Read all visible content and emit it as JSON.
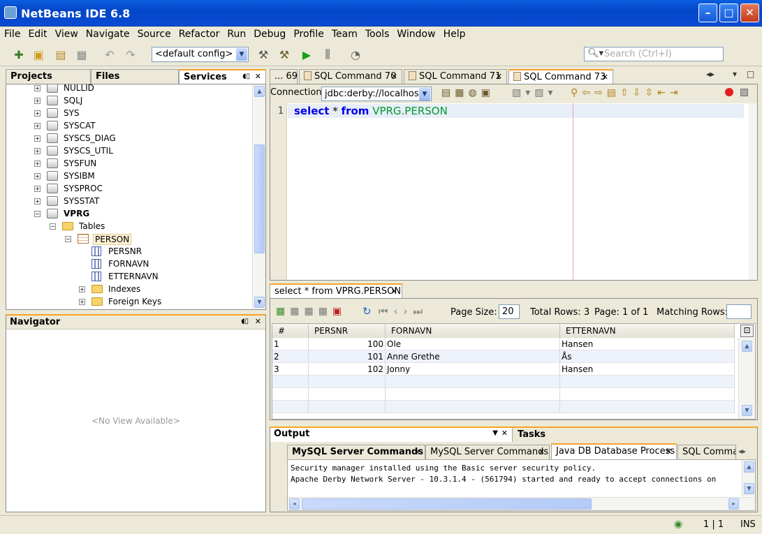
{
  "window": {
    "title": "NetBeans IDE 6.8"
  },
  "menu": [
    "File",
    "Edit",
    "View",
    "Navigate",
    "Source",
    "Refactor",
    "Run",
    "Debug",
    "Profile",
    "Team",
    "Tools",
    "Window",
    "Help"
  ],
  "toolbar": {
    "config_value": "<default config>",
    "search_placeholder": "Search (Ctrl+I)"
  },
  "left_tabs": {
    "projects": "Projects",
    "files": "Files",
    "services": "Services"
  },
  "tree": {
    "schemas": [
      "NULLID",
      "SQLJ",
      "SYS",
      "SYSCAT",
      "SYSCS_DIAG",
      "SYSCS_UTIL",
      "SYSFUN",
      "SYSIBM",
      "SYSPROC",
      "SYSSTAT",
      "VPRG"
    ],
    "tables_label": "Tables",
    "table_name": "PERSON",
    "columns": [
      "PERSNR",
      "FORNAVN",
      "ETTERNAVN"
    ],
    "indexes_label": "Indexes",
    "foreign_keys_label": "Foreign Keys"
  },
  "navigator": {
    "title": "Navigator",
    "empty_text": "<No View Available>"
  },
  "editor_tabs": [
    "... 69",
    "SQL Command 70",
    "SQL Command 71",
    "SQL Command 73"
  ],
  "connection": {
    "label": "Connection:",
    "value": "jdbc:derby://localhos..."
  },
  "editor": {
    "line_number": "1",
    "kw_select": "select",
    "star": "*",
    "kw_from": "from",
    "table_ref": "VPRG.PERSON"
  },
  "results": {
    "tab_label": "select * from VPRG.PERSON",
    "page_size_label": "Page Size:",
    "page_size_value": "20",
    "total_rows": "Total Rows: 3",
    "page_info": "Page: 1 of 1",
    "matching_rows": "Matching Rows:",
    "columns": [
      "#",
      "PERSNR",
      "FORNAVN",
      "ETTERNAVN"
    ],
    "rows": [
      [
        "1",
        "100",
        "Ole",
        "Hansen"
      ],
      [
        "2",
        "101",
        "Anne Grethe",
        "Ås"
      ],
      [
        "3",
        "102",
        "Jonny",
        "Hansen"
      ]
    ]
  },
  "output": {
    "title": "Output",
    "tasks_label": "Tasks",
    "tabs": [
      "MySQL Server Commands",
      "MySQL Server Commands",
      "Java DB Database Process",
      "SQL Commar"
    ],
    "lines": [
      "Security manager installed using the Basic server security policy.",
      "Apache Derby Network Server - 10.3.1.4 - (561794) started and ready to accept connections on"
    ]
  },
  "status": {
    "position": "1 | 1",
    "mode": "INS"
  }
}
